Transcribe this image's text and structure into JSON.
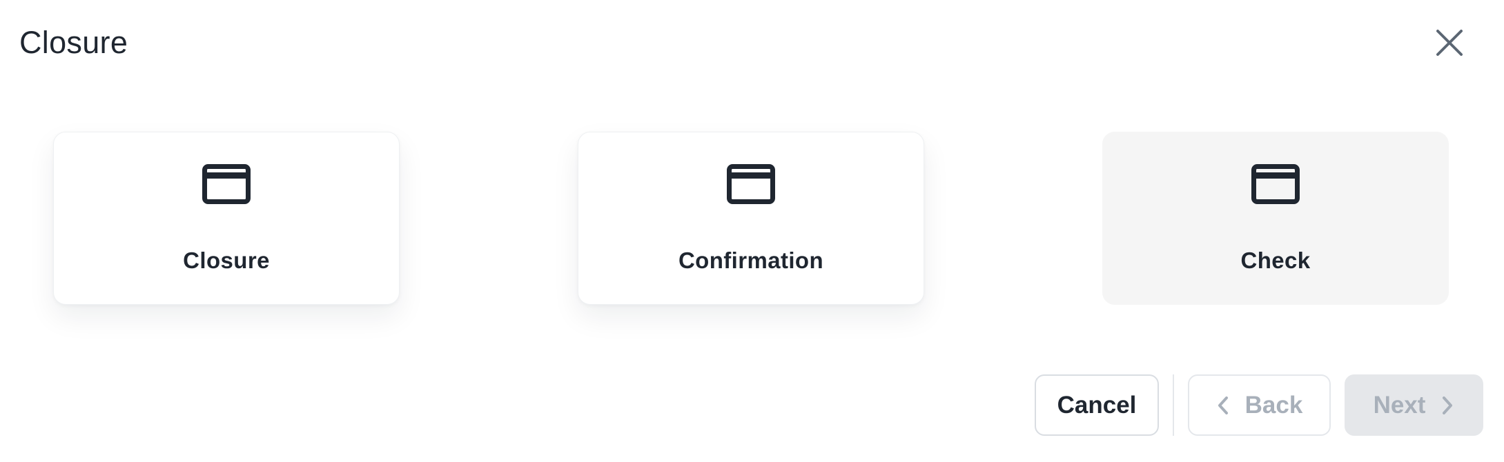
{
  "dialog": {
    "title": "Closure",
    "close_icon": "close-icon"
  },
  "options": [
    {
      "label": "Closure",
      "icon": "credit-card-icon",
      "selected": false
    },
    {
      "label": "Confirmation",
      "icon": "credit-card-icon",
      "selected": false
    },
    {
      "label": "Check",
      "icon": "credit-card-icon",
      "selected": true
    }
  ],
  "footer": {
    "cancel_label": "Cancel",
    "back_label": "Back",
    "next_label": "Next",
    "back_icon": "chevron-left-icon",
    "next_icon": "chevron-right-icon"
  },
  "colors": {
    "text": "#1f2630",
    "muted": "#a8b0ba",
    "selected_bg": "#f5f5f5",
    "disabled_bg": "#e5e7ea",
    "border": "#d9dde2"
  }
}
